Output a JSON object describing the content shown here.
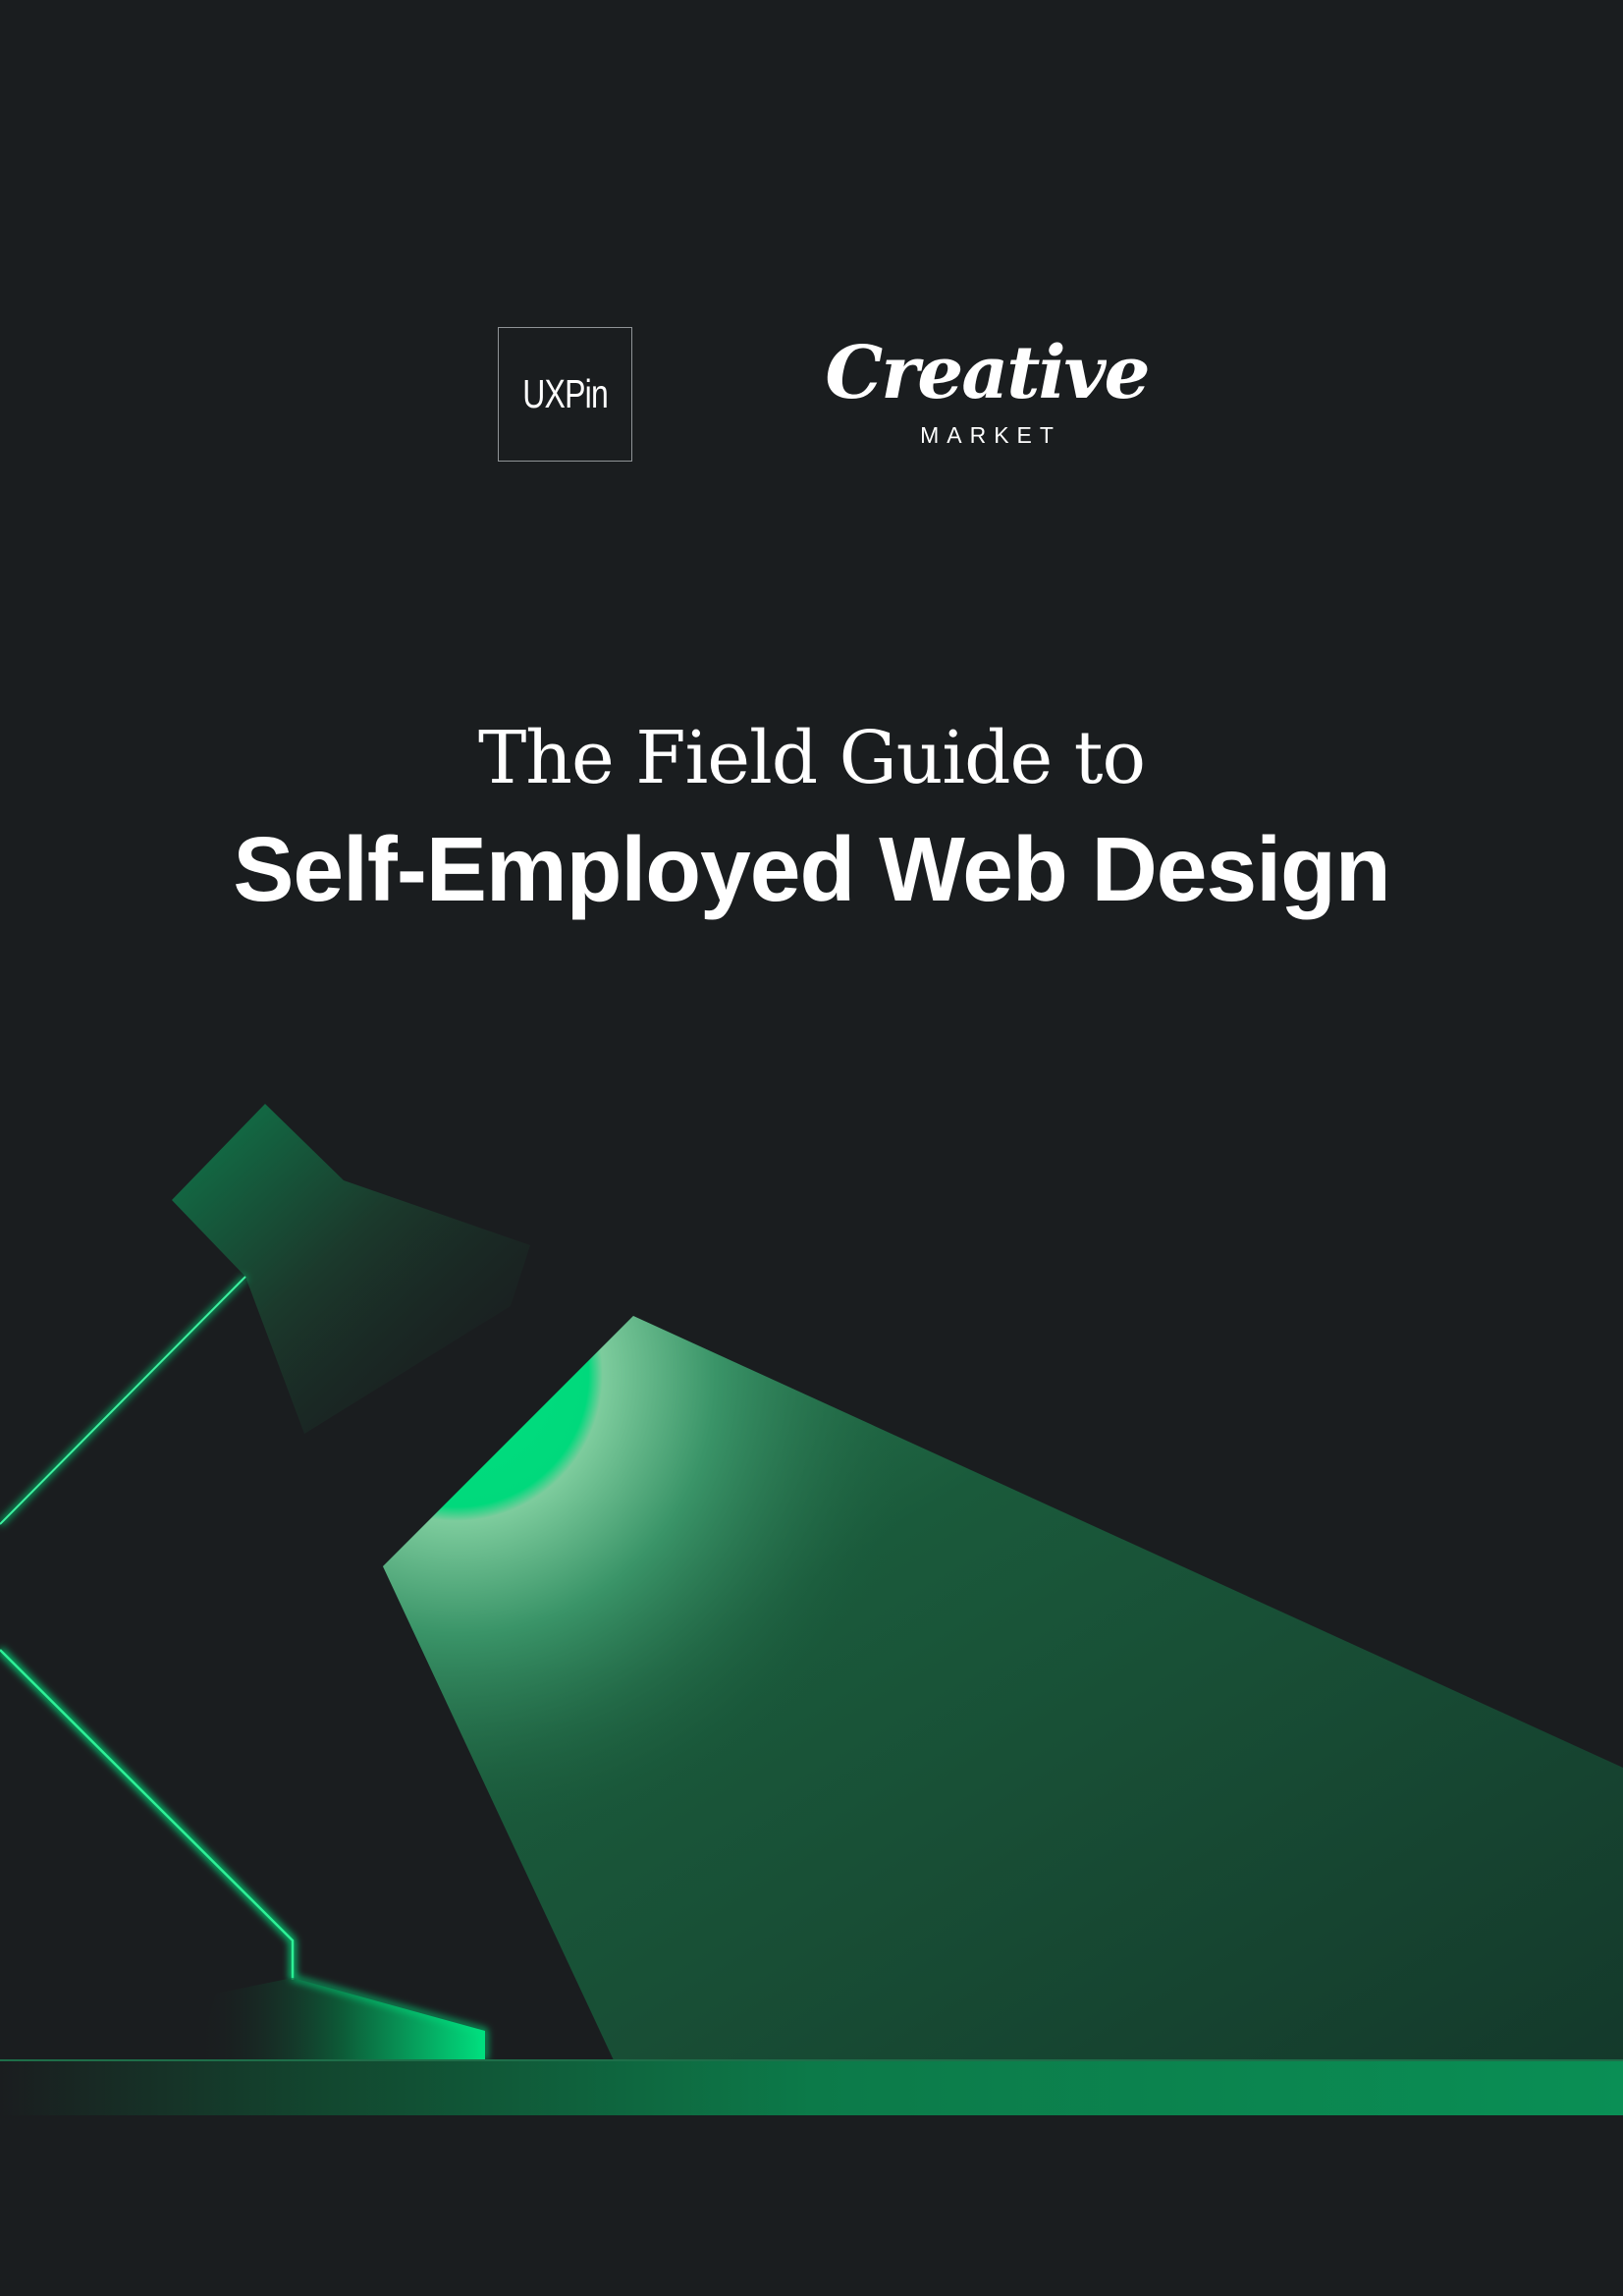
{
  "logos": {
    "uxpin": "UXPin",
    "creative_market": {
      "script": "Creative",
      "sub": "MARKET"
    }
  },
  "cover": {
    "subtitle": "The Field Guide to",
    "title": "Self-Employed Web Design"
  },
  "colors": {
    "background": "#1a1d1f",
    "accent": "#00e07f",
    "beam": "#1a5a3c",
    "floor": "#0a8f55"
  }
}
